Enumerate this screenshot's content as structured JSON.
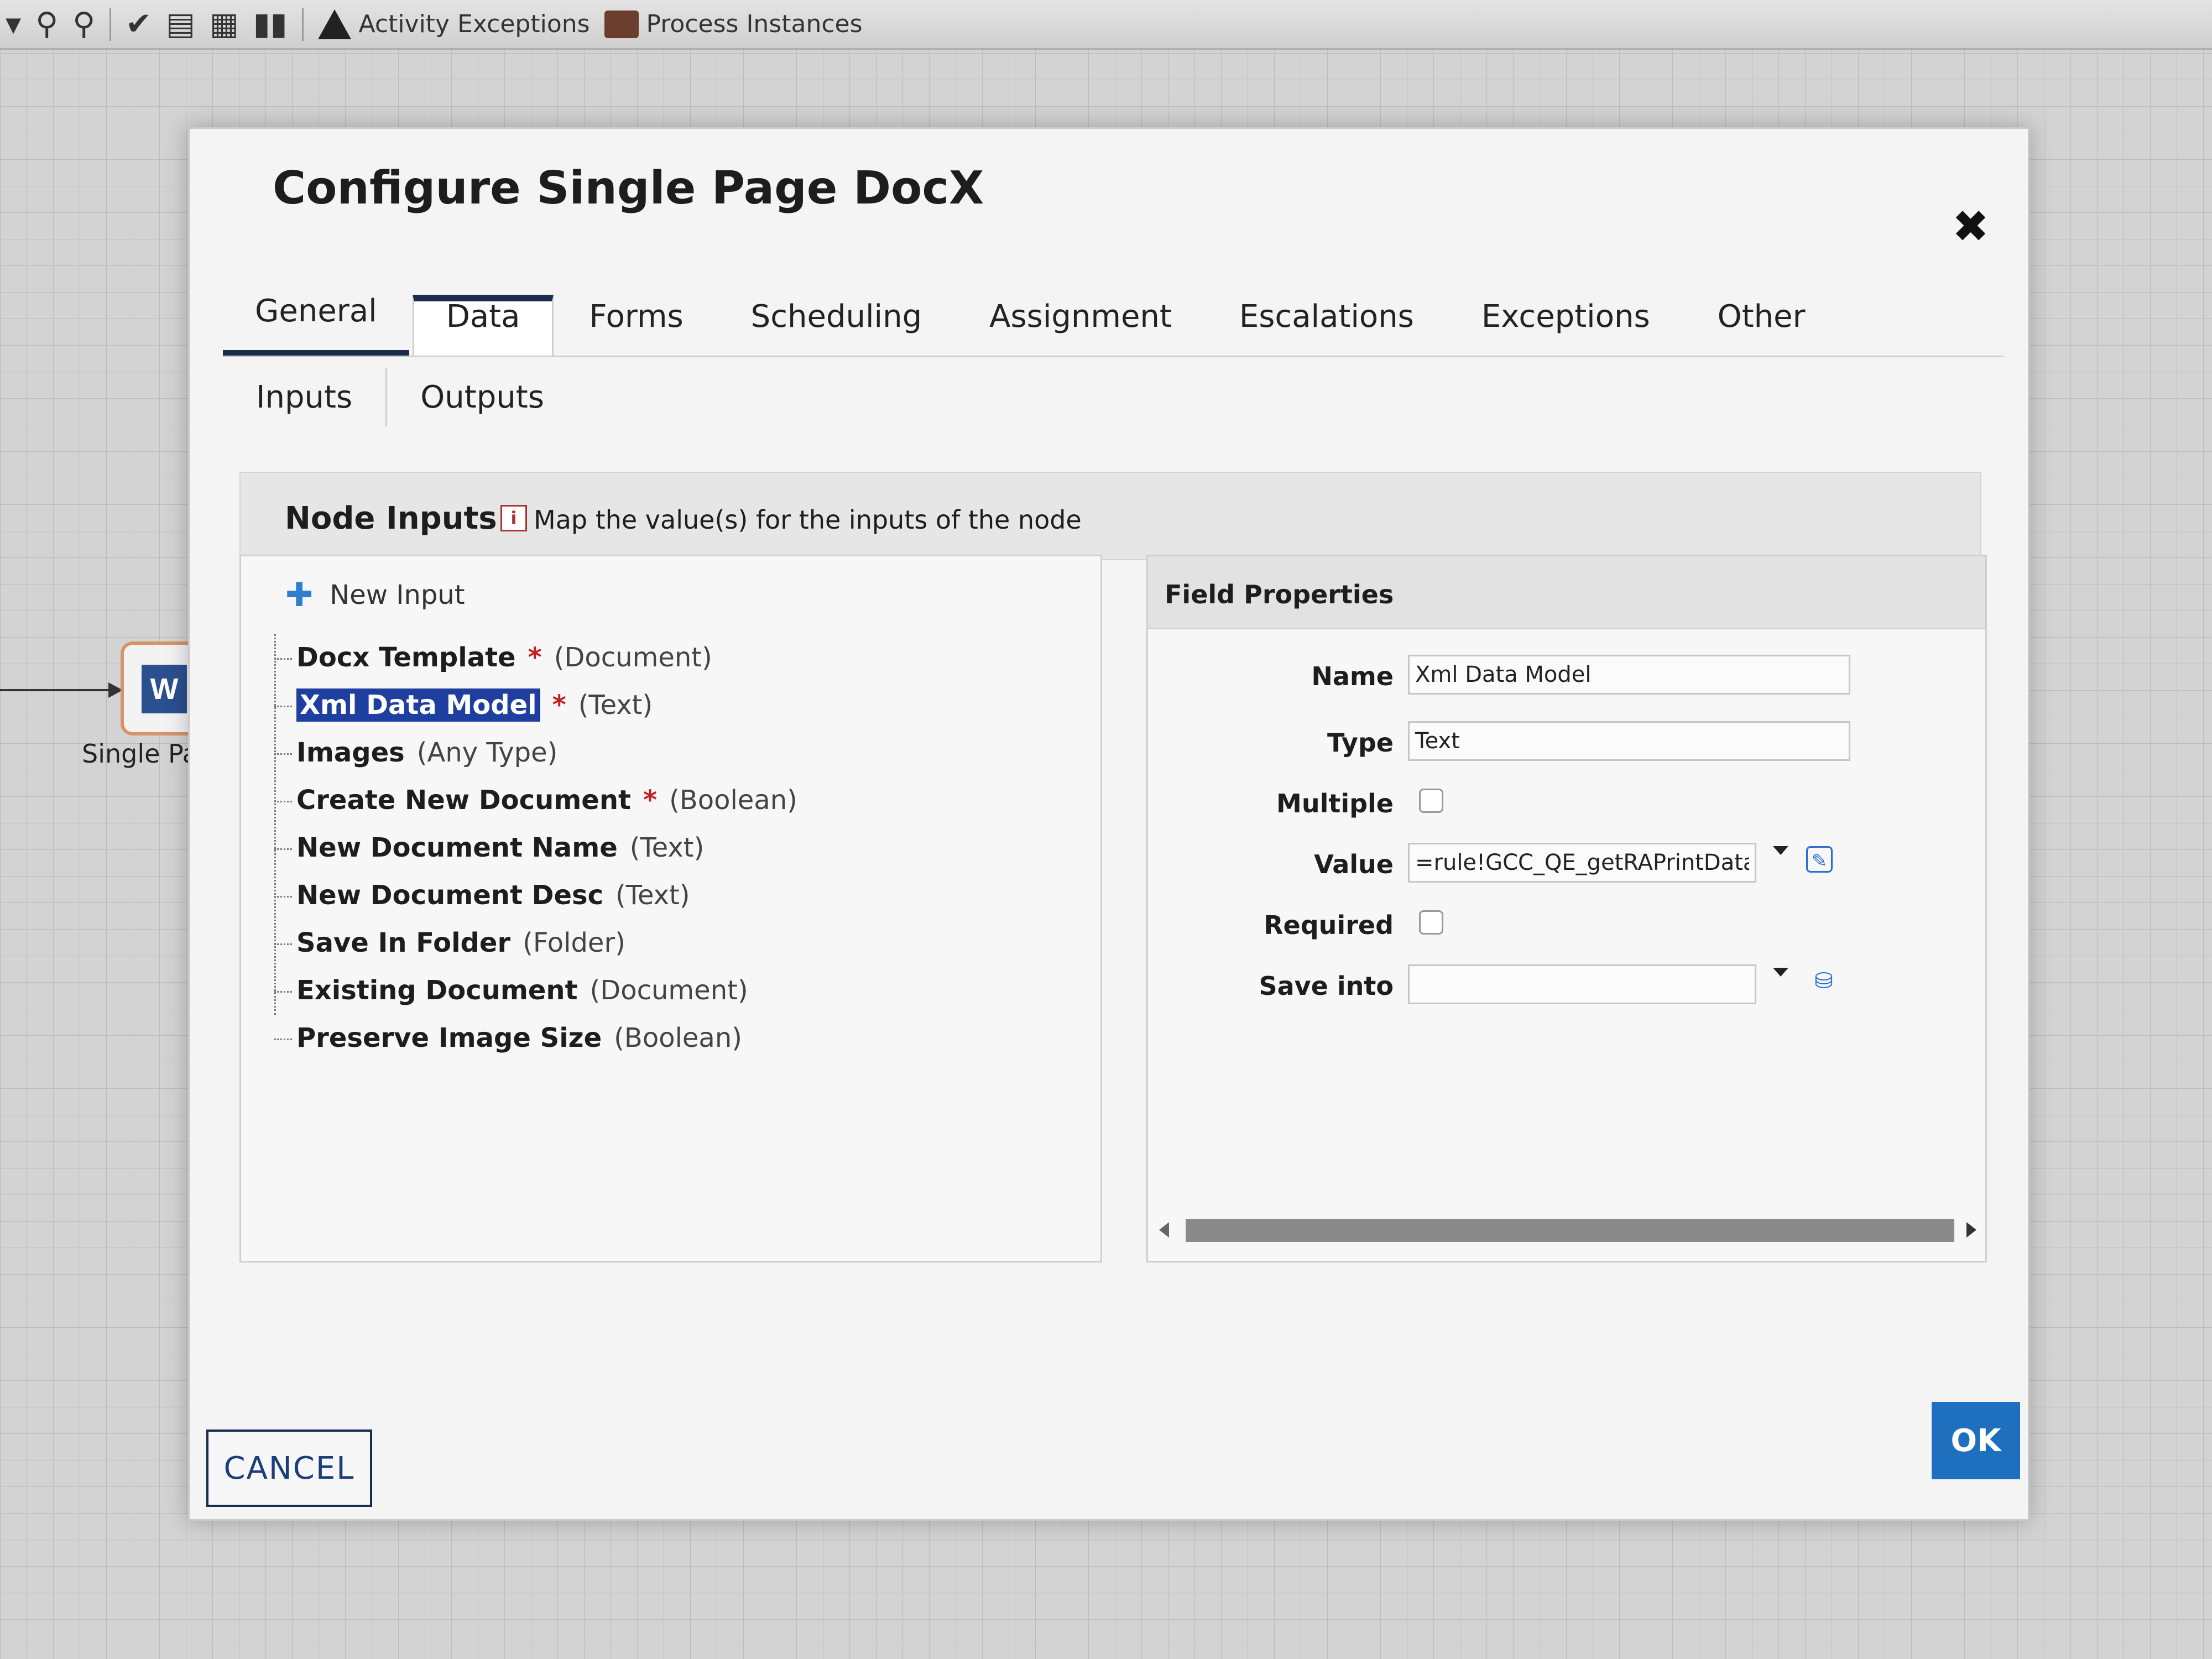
{
  "toolbar": {
    "icons": [
      "dropdown-caret-icon",
      "zoom-out-icon",
      "zoom-in-icon",
      "check-icon",
      "form-icon",
      "grid-icon",
      "bar-chart-icon"
    ],
    "activity_exceptions_label": "Activity Exceptions",
    "process_instances_label": "Process Instances"
  },
  "canvas": {
    "node_label": "Single Pag",
    "node_icon_letter": "W"
  },
  "dialog": {
    "title": "Configure Single Page DocX",
    "close_glyph": "✖",
    "tabs": [
      {
        "label": "General"
      },
      {
        "label": "Data"
      },
      {
        "label": "Forms"
      },
      {
        "label": "Scheduling"
      },
      {
        "label": "Assignment"
      },
      {
        "label": "Escalations"
      },
      {
        "label": "Exceptions"
      },
      {
        "label": "Other"
      }
    ],
    "active_tab": "Data",
    "subtabs": [
      {
        "label": "Inputs"
      },
      {
        "label": "Outputs"
      }
    ],
    "active_subtab": "Inputs",
    "node_inputs": {
      "title": "Node Inputs",
      "info_text": "Map the value(s) for the inputs of the node",
      "new_input_label": "New Input",
      "items": [
        {
          "name": "Docx Template",
          "required": "*",
          "type": "(Document)"
        },
        {
          "name": "Xml Data Model",
          "required": "*",
          "type": "(Text)",
          "selected": true
        },
        {
          "name": "Images",
          "required": "",
          "type": "(Any Type)"
        },
        {
          "name": "Create New Document",
          "required": "*",
          "type": "(Boolean)"
        },
        {
          "name": "New Document Name",
          "required": "",
          "type": "(Text)"
        },
        {
          "name": "New Document Desc",
          "required": "",
          "type": "(Text)"
        },
        {
          "name": "Save In Folder",
          "required": "",
          "type": "(Folder)"
        },
        {
          "name": "Existing Document",
          "required": "",
          "type": "(Document)"
        },
        {
          "name": "Preserve Image Size",
          "required": "",
          "type": "(Boolean)"
        }
      ]
    },
    "field_properties": {
      "title": "Field Properties",
      "name_label": "Name",
      "name_value": "Xml Data Model",
      "type_label": "Type",
      "type_value": "Text",
      "multiple_label": "Multiple",
      "multiple_checked": false,
      "value_label": "Value",
      "value_value": "=rule!GCC_QE_getRAPrintData(",
      "required_label": "Required",
      "required_checked": false,
      "save_into_label": "Save into",
      "save_into_value": ""
    },
    "cancel_label": "CANCEL",
    "ok_label": "OK"
  },
  "colors": {
    "accent": "#1f6fbf",
    "selection": "#1f3fa0",
    "tab_indicator": "#1b2b4b",
    "required_star": "#c42020"
  }
}
